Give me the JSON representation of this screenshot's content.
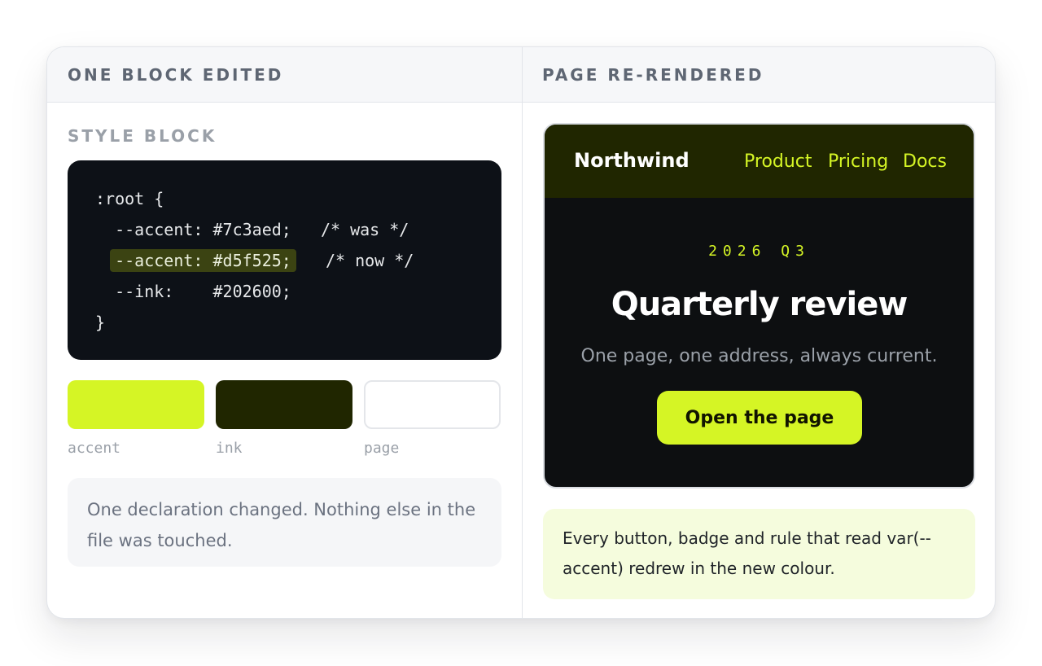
{
  "left_panel": {
    "header": "ONE BLOCK EDITED",
    "section_label": "STYLE BLOCK",
    "code_lines": [
      ":root {",
      "  --accent: #7c3aed;",
      "   /* was */",
      "--accent: #d5f525;",
      "   /* now */",
      "  --ink:    #202600;",
      "}"
    ],
    "swatches": [
      {
        "label": "accent",
        "color": "#d5f525"
      },
      {
        "label": "ink",
        "color": "#202600"
      },
      {
        "label": "page",
        "color": "#ffffff"
      }
    ],
    "note": "One declaration changed. Nothing else in the file was touched."
  },
  "right_panel": {
    "header": "PAGE RE-RENDERED",
    "preview": {
      "brand": "Northwind",
      "nav_links": [
        "Product",
        "Pricing",
        "Docs"
      ],
      "eyebrow": "2026 Q3",
      "title": "Quarterly review",
      "subtitle": "One page, one address, always current.",
      "button": "Open the page"
    },
    "note": "Every button, badge and rule that read var(--accent) redrew in the new colour."
  },
  "colors": {
    "accent": "#d5f525",
    "ink": "#202600",
    "code_bg": "#0d1117"
  }
}
